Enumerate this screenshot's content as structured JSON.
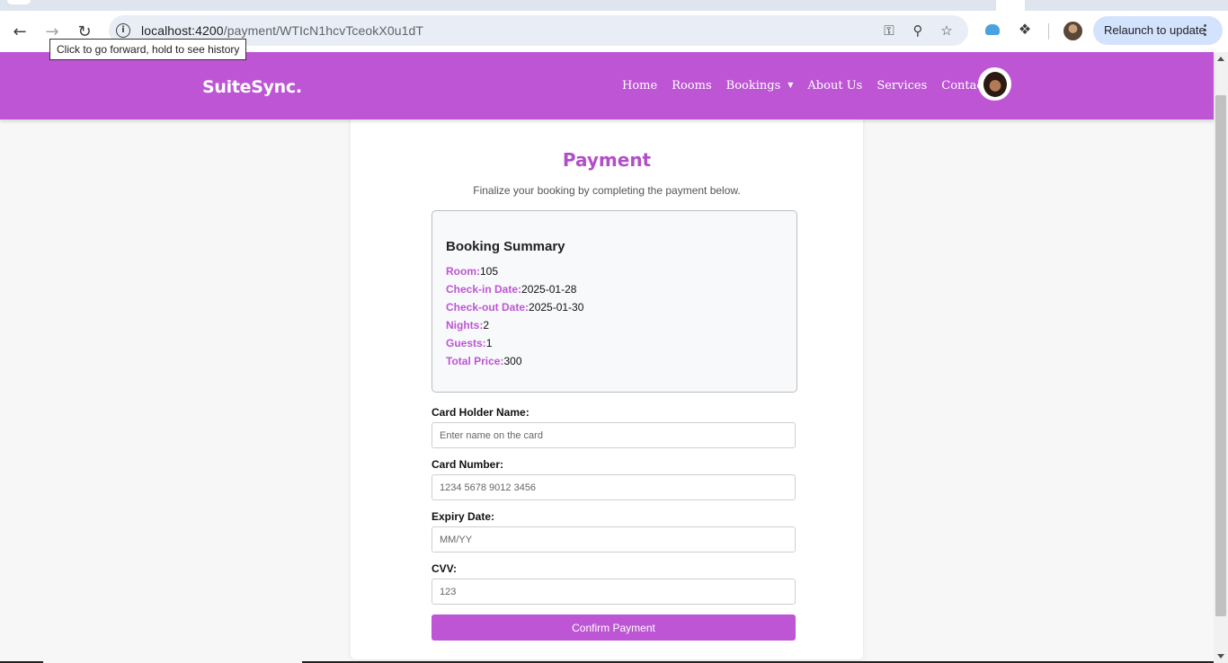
{
  "browser": {
    "url_host": "localhost:4200",
    "url_path": "/payment/WTIcN1hcvTceokX0u1dT",
    "tooltip": "Click to go forward, hold to see history",
    "relaunch_label": "Relaunch to update",
    "icons": [
      "back-icon",
      "forward-icon",
      "reload-icon",
      "site-info-icon",
      "password-key-icon",
      "zoom-icon",
      "bookmark-star-icon",
      "cloud-extension-icon",
      "extensions-puzzle-icon",
      "profile-avatar",
      "menu-dots-icon"
    ]
  },
  "site": {
    "brand": "SuiteSync.",
    "nav": [
      "Home",
      "Rooms",
      "Bookings",
      "About Us",
      "Services",
      "Contact"
    ],
    "accent_color": "#bd55d5"
  },
  "payment": {
    "title": "Payment",
    "subtitle": "Finalize your booking by completing the payment below.",
    "summary": {
      "heading": "Booking Summary",
      "rows": [
        {
          "label": "Room:",
          "value": "105"
        },
        {
          "label": "Check-in Date:",
          "value": "2025-01-28"
        },
        {
          "label": "Check-out Date:",
          "value": "2025-01-30"
        },
        {
          "label": "Nights:",
          "value": "2"
        },
        {
          "label": "Guests:",
          "value": "1"
        },
        {
          "label": "Total Price:",
          "value": "300"
        }
      ]
    },
    "fields": [
      {
        "label": "Card Holder Name:",
        "placeholder": "Enter name on the card"
      },
      {
        "label": "Card Number:",
        "placeholder": "1234 5678 9012 3456"
      },
      {
        "label": "Expiry Date:",
        "placeholder": "MM/YY"
      },
      {
        "label": "CVV:",
        "placeholder": "123"
      }
    ],
    "confirm_label": "Confirm Payment"
  }
}
